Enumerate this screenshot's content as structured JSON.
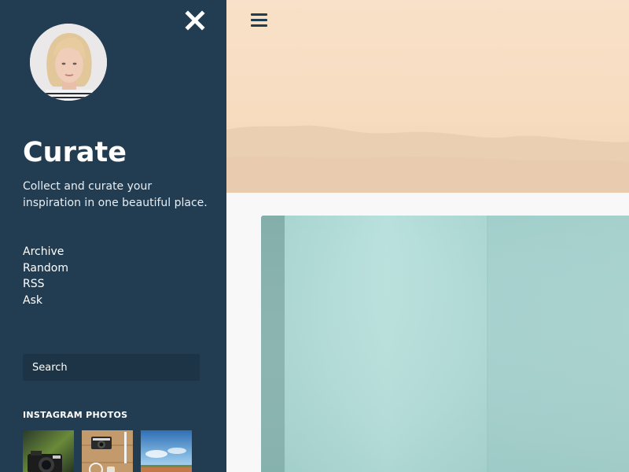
{
  "sidebar": {
    "title": "Curate",
    "description": "Collect and curate your inspiration in one beautiful place.",
    "nav": [
      {
        "label": "Archive"
      },
      {
        "label": "Random"
      },
      {
        "label": "RSS"
      },
      {
        "label": "Ask"
      }
    ],
    "search": {
      "placeholder": "Search",
      "value": ""
    },
    "instagram": {
      "heading": "INSTAGRAM PHOTOS",
      "photos": [
        "camera-photo",
        "flatlay-photo",
        "sky-field-photo"
      ]
    },
    "icons": {
      "close": "close-icon",
      "avatar": "avatar"
    }
  },
  "main": {
    "menu_icon": "hamburger-menu-icon",
    "hero": "hazy-mountain-banner",
    "post": "teal-book-cover-photo"
  },
  "colors": {
    "sidebar_bg": "#223d52",
    "search_bg": "#1c3446",
    "main_bg": "#f8f8f8",
    "menu_icon": "#223d52"
  }
}
